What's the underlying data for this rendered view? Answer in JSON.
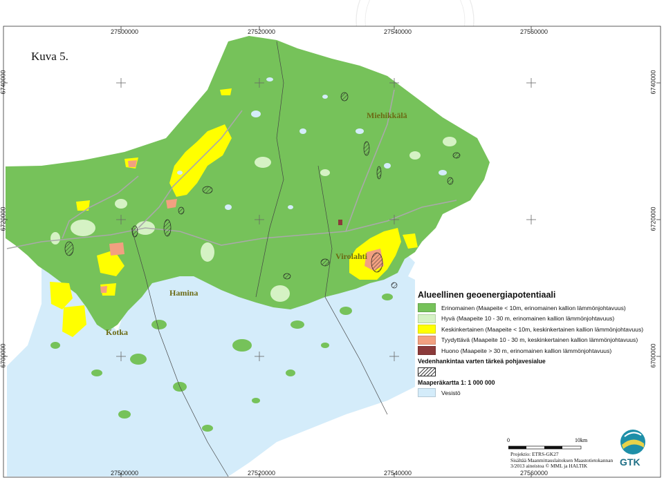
{
  "figure_label": "Kuva 5.",
  "x_ticks": [
    "27500000",
    "27520000",
    "27540000",
    "27560000"
  ],
  "y_ticks": [
    "6740000",
    "6720000",
    "6700000"
  ],
  "places": {
    "miehikkala": "Miehikkälä",
    "virolahti": "Virolahti",
    "hamina": "Hamina",
    "kotka": "Kotka"
  },
  "legend": {
    "title": "Alueellinen geoenergiapotentiaali",
    "classes": [
      {
        "label": "Erinomainen (Maapeite < 10m, erinomainen kallion lämmönjohtavuus)",
        "color": "#76c25a"
      },
      {
        "label": "Hyvä (Maapeite 10 - 30 m, erinomainen kallion lämmönjohtavuus)",
        "color": "#d5f2c4"
      },
      {
        "label": "Keskinkertainen (Maapeite < 10m, keskinkertainen kallion lämmönjohtavuus)",
        "color": "#ffff00"
      },
      {
        "label": "Tyydyttävä (Maapeite 10 - 30 m, keskinkertainen kallion lämmönjohtavuus)",
        "color": "#f2a080"
      },
      {
        "label": "Huono (Maapeite > 30 m, erinomainen kallion lämmönjohtavuus)",
        "color": "#8b3a3a"
      }
    ],
    "groundwater_header": "Vedenhankintaa varten tärkeä pohjavesialue",
    "soil_header": "Maaperäkartta 1: 1 000 000",
    "water_label": "Vesistö",
    "water_color": "#d4ecfa"
  },
  "scale": {
    "zero": "0",
    "end": "10km"
  },
  "projection": {
    "line1": "Projektio: ETRS-GK27",
    "line2": "Sisältää Maanmittauslaitoksen Maastotietokannan",
    "line3": "3/2013 aineistoa © MML ja HALTIK"
  },
  "logo_text": "GTK"
}
